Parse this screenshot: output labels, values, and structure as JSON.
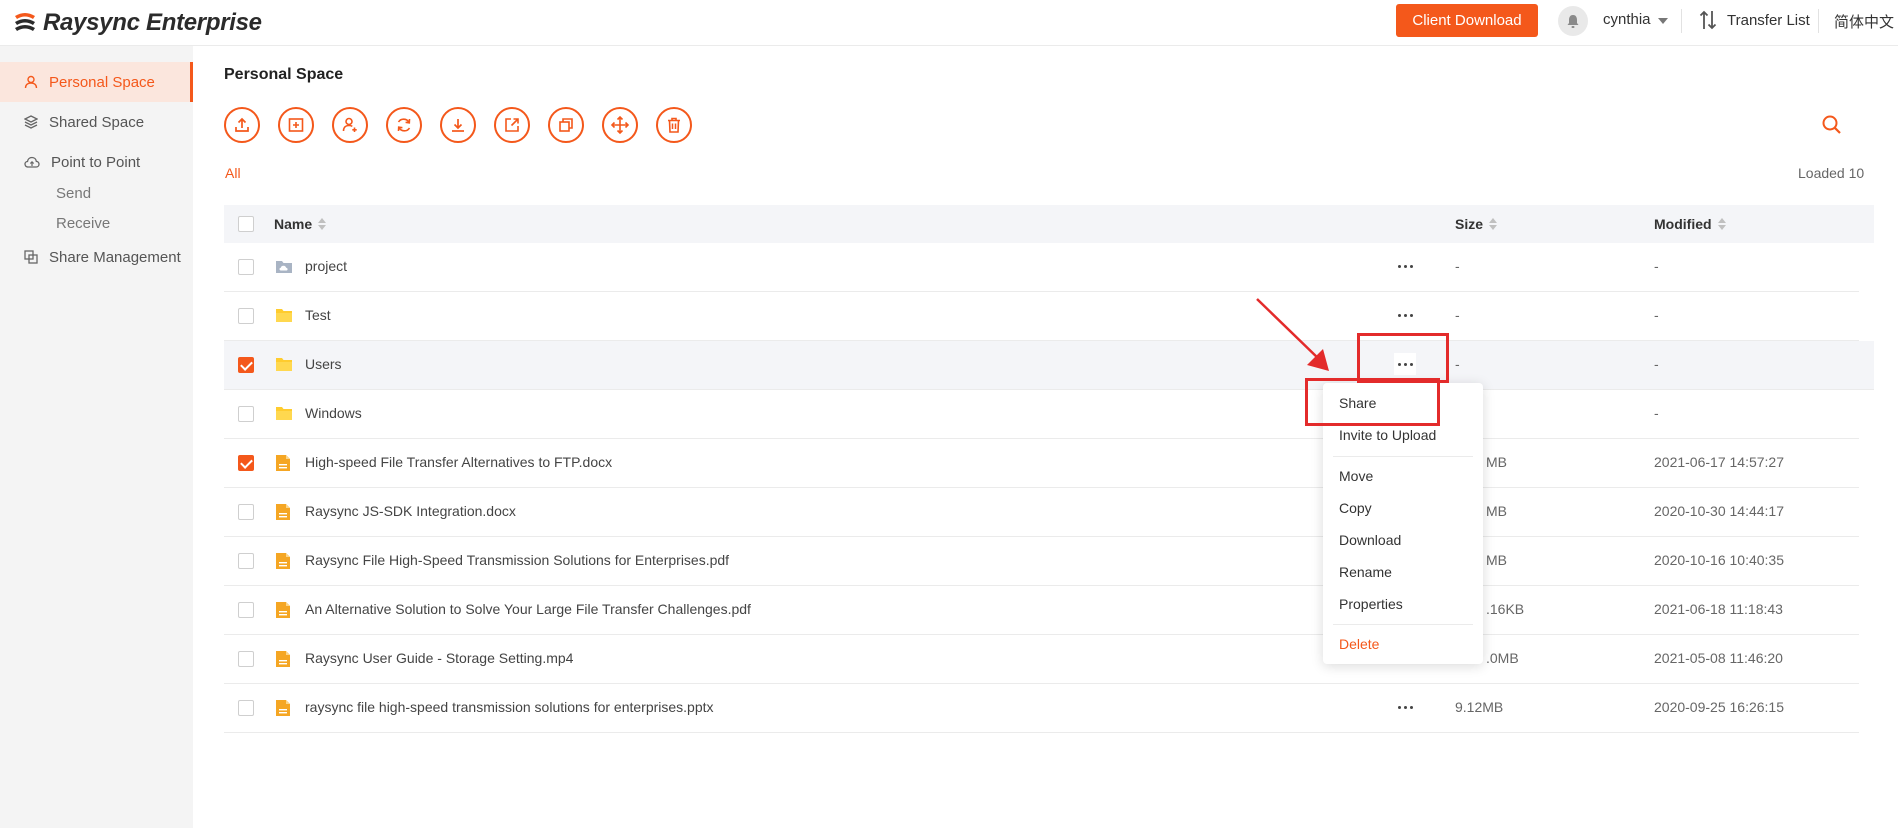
{
  "app": {
    "brand": "Raysync Enterprise",
    "accent": "#f4581b"
  },
  "header": {
    "client_download": "Client Download",
    "username": "cynthia",
    "transfer_list": "Transfer List",
    "language": "简体中文"
  },
  "sidebar": {
    "items": [
      {
        "label": "Personal Space",
        "icon": "user-icon",
        "active": true
      },
      {
        "label": "Shared Space",
        "icon": "layers-icon"
      },
      {
        "label": "Point to Point",
        "icon": "cloud-icon"
      },
      {
        "label": "Send",
        "sub": true
      },
      {
        "label": "Receive",
        "sub": true
      },
      {
        "label": "Share Management",
        "icon": "share-manage-icon"
      }
    ]
  },
  "main": {
    "title": "Personal Space",
    "toolbar_icons": [
      "upload-icon",
      "new-folder-icon",
      "add-user-icon",
      "sync-icon",
      "download-icon",
      "share-link-icon",
      "copy-icon",
      "move-icon",
      "delete-icon"
    ],
    "filter_all": "All",
    "loaded": "Loaded 10",
    "columns": {
      "name": "Name",
      "size": "Size",
      "modified": "Modified"
    },
    "rows": [
      {
        "name": "project",
        "type": "cloud-folder",
        "size": "-",
        "modified": "-",
        "checked": false,
        "more": true
      },
      {
        "name": "Test",
        "type": "folder",
        "size": "-",
        "modified": "-",
        "checked": false,
        "more": true
      },
      {
        "name": "Users",
        "type": "folder",
        "size": "-",
        "modified": "-",
        "checked": true,
        "more": true,
        "selected": true
      },
      {
        "name": "Windows",
        "type": "folder",
        "size": "",
        "modified": "-",
        "checked": false,
        "more": false
      },
      {
        "name": "High-speed File Transfer Alternatives to FTP.docx",
        "type": "file",
        "size": "MB",
        "modified": "2021-06-17 14:57:27",
        "checked": true,
        "more": false
      },
      {
        "name": "Raysync JS-SDK Integration.docx",
        "type": "file",
        "size": "MB",
        "modified": "2020-10-30 14:44:17",
        "checked": false,
        "more": false
      },
      {
        "name": "Raysync File High-Speed Transmission Solutions for Enterprises.pdf",
        "type": "file",
        "size": "MB",
        "modified": "2020-10-16 10:40:35",
        "checked": false,
        "more": false
      },
      {
        "name": "An Alternative Solution to Solve Your Large File Transfer Challenges.pdf",
        "type": "file",
        "size": ".16KB",
        "modified": "2021-06-18 11:18:43",
        "checked": false,
        "more": false
      },
      {
        "name": "Raysync User Guide - Storage Setting.mp4",
        "type": "file",
        "size": ".0MB",
        "modified": "2021-05-08 11:46:20",
        "checked": false,
        "more": false
      },
      {
        "name": "raysync file high-speed transmission solutions for enterprises.pptx",
        "type": "file",
        "size": "9.12MB",
        "modified": "2020-09-25 16:26:15",
        "checked": false,
        "more": true
      }
    ]
  },
  "context_menu": {
    "items": [
      "Share",
      "Invite to Upload",
      "Move",
      "Copy",
      "Download",
      "Rename",
      "Properties",
      "Delete"
    ]
  }
}
